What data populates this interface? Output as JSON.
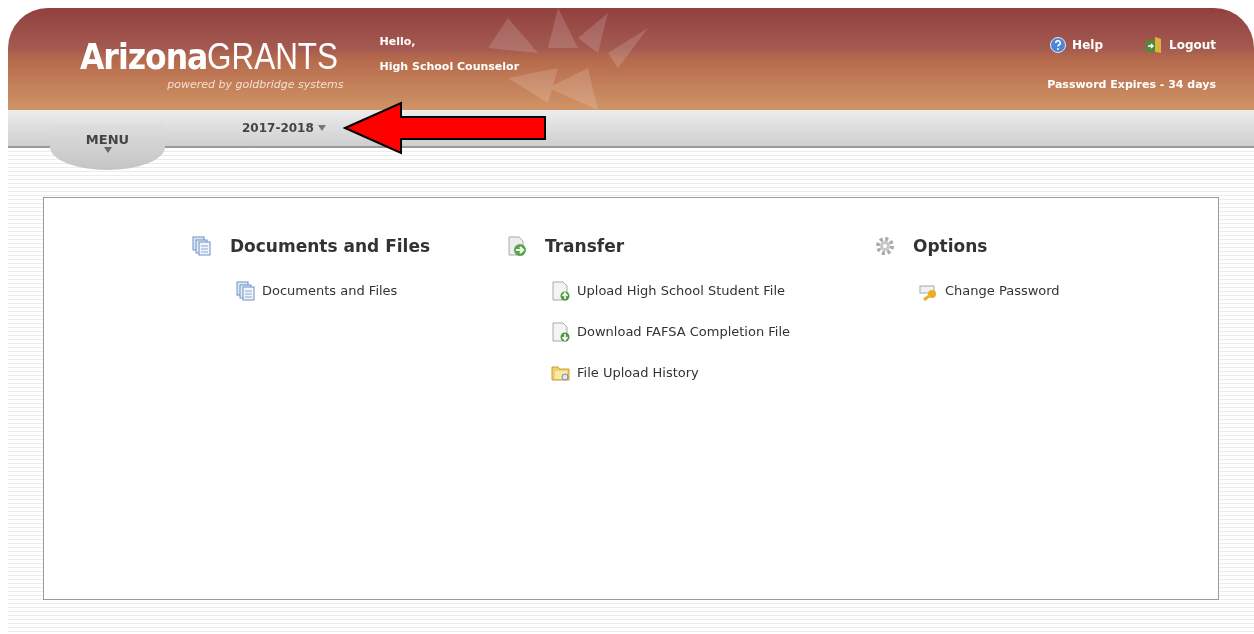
{
  "header": {
    "logo_bold": "Arizona",
    "logo_light": "GRANTS",
    "tagline": "powered by goldbridge systems",
    "greeting": "Hello,",
    "user": "High School Counselor",
    "help": "Help",
    "logout": "Logout",
    "password_notice": "Password Expires - 34 days"
  },
  "menu_bar": {
    "menu": "MENU",
    "year": "2017-2018"
  },
  "sections": [
    {
      "kind": "documents",
      "title": "Documents and Files",
      "items": [
        {
          "kind": "documents",
          "label": "Documents and Files"
        }
      ]
    },
    {
      "kind": "transfer",
      "title": "Transfer",
      "items": [
        {
          "kind": "upload",
          "label": "Upload High School Student File"
        },
        {
          "kind": "download",
          "label": "Download FAFSA Completion File"
        },
        {
          "kind": "folder",
          "label": "File Upload History"
        }
      ]
    },
    {
      "kind": "options",
      "title": "Options",
      "items": [
        {
          "kind": "key",
          "label": "Change Password"
        }
      ]
    }
  ]
}
